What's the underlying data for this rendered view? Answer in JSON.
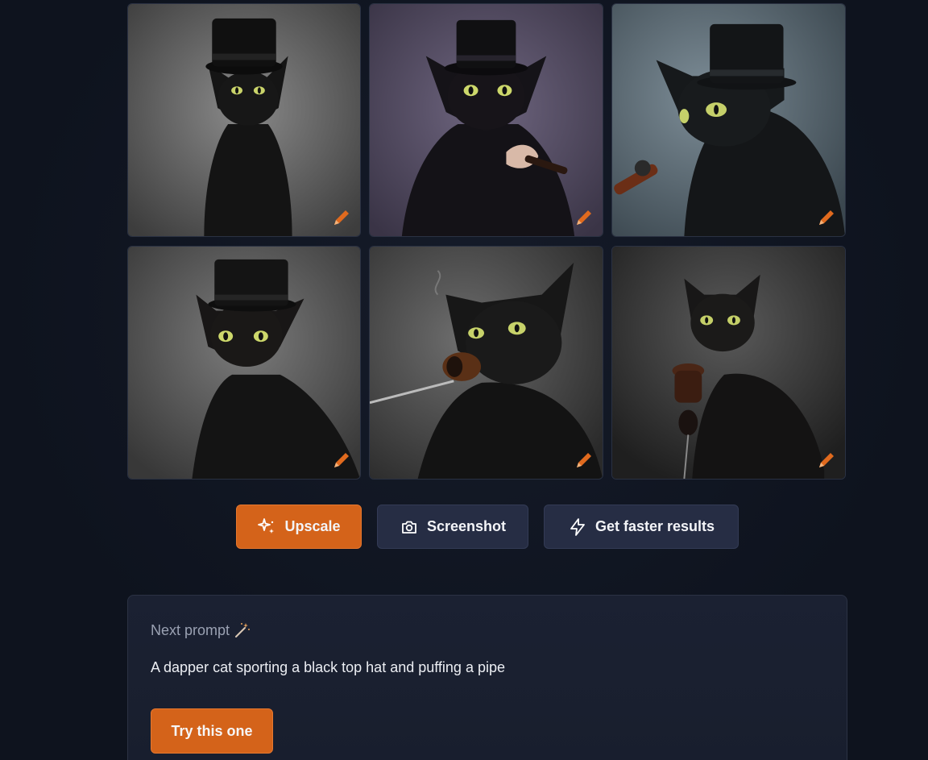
{
  "colors": {
    "accent": "#d4631a",
    "secondary_button": "#262d44",
    "background": "#0f1420"
  },
  "gallery": {
    "images": [
      {
        "subject": "black cat with top hat",
        "edit_icon": "pencil-icon"
      },
      {
        "subject": "black cat with top hat holding pipe",
        "edit_icon": "pencil-icon"
      },
      {
        "subject": "black cat with top hat and pipe profile",
        "edit_icon": "pencil-icon"
      },
      {
        "subject": "black cat with top hat",
        "edit_icon": "pencil-icon"
      },
      {
        "subject": "black cat smoking pipe",
        "edit_icon": "pencil-icon"
      },
      {
        "subject": "black cat sitting with pipe",
        "edit_icon": "pencil-icon"
      }
    ]
  },
  "actions": {
    "upscale_label": "Upscale",
    "upscale_icon": "sparkles-icon",
    "screenshot_label": "Screenshot",
    "screenshot_icon": "camera-icon",
    "faster_label": "Get faster results",
    "faster_icon": "lightning-icon"
  },
  "next_prompt": {
    "label": "Next prompt",
    "label_icon": "magic-wand-icon",
    "text": "A dapper cat sporting a black top hat and puffing a pipe",
    "button_label": "Try this one"
  }
}
